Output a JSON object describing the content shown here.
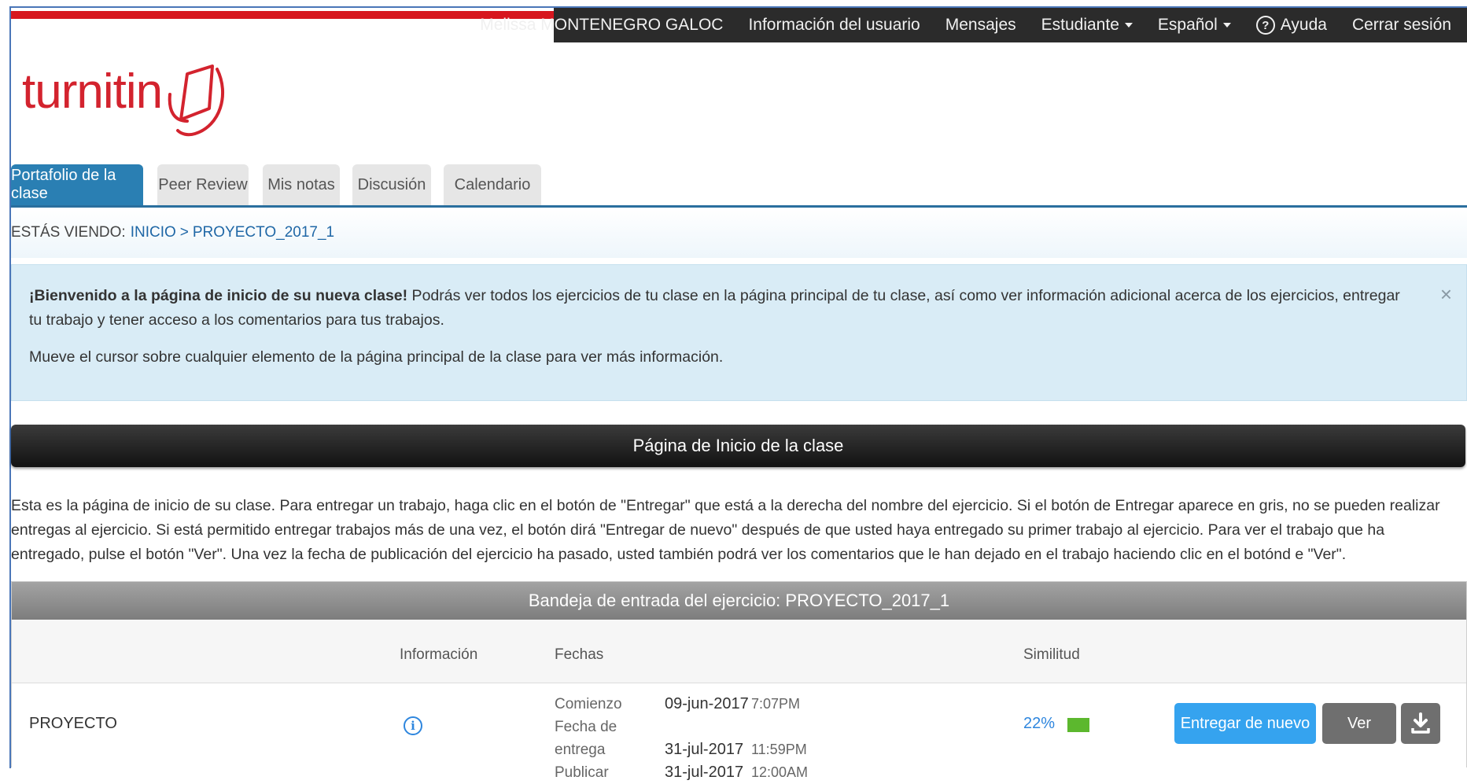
{
  "topnav": {
    "user_name": "Melissa MONTENEGRO GALOC",
    "user_info": "Información del usuario",
    "messages": "Mensajes",
    "role": "Estudiante",
    "language": "Español",
    "help": "Ayuda",
    "help_icon": "?",
    "logout": "Cerrar sesión"
  },
  "logo": {
    "text": "turnitin",
    "color": "#d3232e"
  },
  "tabs": [
    {
      "label": "Portafolio de la clase",
      "active": true
    },
    {
      "label": "Peer Review"
    },
    {
      "label": "Mis notas"
    },
    {
      "label": "Discusión"
    },
    {
      "label": "Calendario"
    }
  ],
  "breadcrumb": {
    "label": "ESTÁS VIENDO:",
    "home": "INICIO",
    "separator": ">",
    "current": "PROYECTO_2017_1"
  },
  "welcome": {
    "bold": "¡Bienvenido a la página de inicio de su nueva clase!",
    "text": " Podrás ver todos los ejercicios de tu clase en la página principal de tu clase, así como ver información adicional acerca de los ejercicios, entregar tu trabajo y tener acceso a los comentarios para tus trabajos.",
    "hint": "Mueve el cursor sobre cualquier elemento de la página principal de la clase para ver más información.",
    "close": "×"
  },
  "home_header": "Página de Inicio de la clase",
  "instructions": "Esta es la página de inicio de su clase. Para entregar un trabajo, haga clic en el botón de \"Entregar\" que está a la derecha del nombre del ejercicio. Si el botón de Entregar aparece en gris, no se pueden realizar entregas al ejercicio. Si está permitido entregar trabajos más de una vez, el botón dirá \"Entregar de nuevo\" después de que usted haya entregado su primer trabajo al ejercicio. Para ver el trabajo que ha entregado, pulse el botón \"Ver\". Una vez la fecha de publicación del ejercicio ha pasado, usted también podrá ver los comentarios que le han dejado en el trabajo haciendo clic en el botónd e \"Ver\".",
  "inbox": {
    "title": "Bandeja de entrada del ejercicio: PROYECTO_2017_1",
    "columns": {
      "info": "Información",
      "dates": "Fechas",
      "similarity": "Similitud"
    },
    "assignment": {
      "name": "PROYECTO",
      "info_icon": "i",
      "dates": [
        {
          "label": "Comienzo",
          "date": "09-jun-2017",
          "time": "7:07PM"
        },
        {
          "label": "Fecha de entrega",
          "date": "31-jul-2017",
          "time": "11:59PM"
        },
        {
          "label": "Publicar",
          "date": "31-jul-2017",
          "time": "12:00AM"
        }
      ],
      "similarity": "22%",
      "similarity_color": "#5cb82e",
      "resubmit_label": "Entregar de nuevo",
      "view_label": "Ver",
      "download_icon": "download-icon"
    }
  }
}
